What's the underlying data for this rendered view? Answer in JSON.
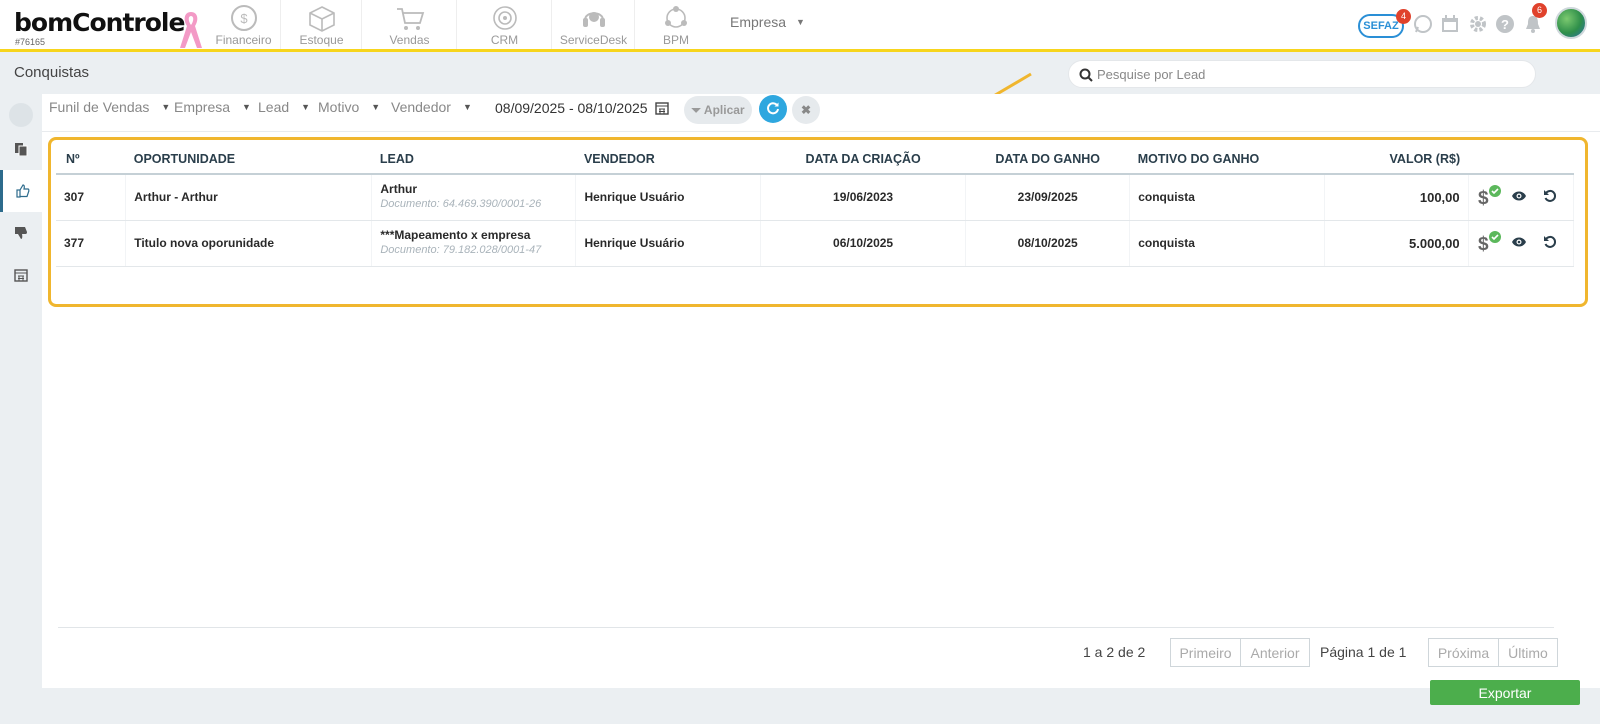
{
  "app": {
    "logo_text": "bomControle",
    "account_code": "#76165"
  },
  "modules": [
    {
      "label": "Financeiro",
      "icon": "dollar-circle-icon"
    },
    {
      "label": "Estoque",
      "icon": "box-icon"
    },
    {
      "label": "Vendas",
      "icon": "cart-icon"
    },
    {
      "label": "CRM",
      "icon": "target-icon"
    },
    {
      "label": "ServiceDesk",
      "icon": "headset-icon"
    },
    {
      "label": "BPM",
      "icon": "process-icon"
    }
  ],
  "company_selector": {
    "label": "Empresa"
  },
  "header_icons": {
    "sefaz_label": "SEFAZ",
    "sefaz_badge": "4",
    "notifications_badge": "6"
  },
  "page": {
    "title": "Conquistas"
  },
  "search": {
    "placeholder": "Pesquise por Lead"
  },
  "filters": {
    "funnel": "Funil de Vendas",
    "company": "Empresa",
    "lead": "Lead",
    "reason": "Motivo",
    "seller": "Vendedor",
    "date_range": "08/09/2025 - 08/10/2025",
    "apply_label": "Aplicar"
  },
  "table": {
    "columns": [
      "Nº",
      "OPORTUNIDADE",
      "LEAD",
      "VENDEDOR",
      "DATA DA CRIAÇÃO",
      "DATA DO GANHO",
      "MOTIVO DO GANHO",
      "VALOR (R$)"
    ],
    "rows": [
      {
        "num": "307",
        "opportunity": "Arthur - Arthur",
        "lead": "Arthur",
        "document": "Documento: 64.469.390/0001-26",
        "seller": "Henrique Usuário",
        "created": "19/06/2023",
        "won": "23/09/2025",
        "reason": "conquista",
        "value": "100,00"
      },
      {
        "num": "377",
        "opportunity": "Titulo nova oporunidade",
        "lead": "***Mapeamento x empresa",
        "document": "Documento: 79.182.028/0001-47",
        "seller": "Henrique Usuário",
        "created": "06/10/2025",
        "won": "08/10/2025",
        "reason": "conquista",
        "value": "5.000,00"
      }
    ]
  },
  "pagination": {
    "range_text": "1 a 2 de 2",
    "first": "Primeiro",
    "previous": "Anterior",
    "page_text": "Página 1 de 1",
    "next": "Próxima",
    "last": "Último"
  },
  "export_label": "Exportar",
  "colors": {
    "accent_yellow": "#f7d51d",
    "highlight_orange": "#f0b62e",
    "primary_blue": "#2ea7df",
    "export_green": "#4cae4c",
    "badge_red": "#e0422c"
  }
}
